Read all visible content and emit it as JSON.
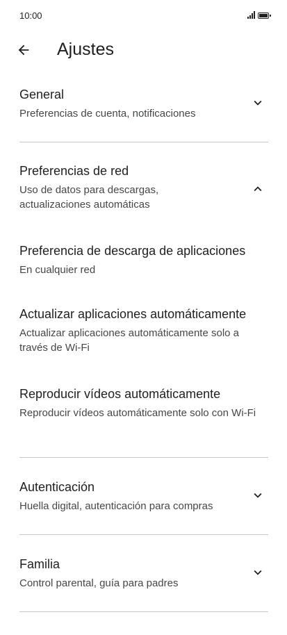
{
  "status": {
    "time": "10:00"
  },
  "header": {
    "title": "Ajustes"
  },
  "sections": [
    {
      "title": "General",
      "subtitle": "Preferencias de cuenta, notificaciones"
    },
    {
      "title": "Preferencias de red",
      "subtitle": "Uso de datos para descargas, actualizaciones automáticas"
    },
    {
      "title": "Preferencia de descarga de aplicaciones",
      "subtitle": "En cualquier red"
    },
    {
      "title": "Actualizar aplicaciones automáticamente",
      "subtitle": "Actualizar aplicaciones automáticamente solo a través de Wi-Fi"
    },
    {
      "title": "Reproducir vídeos automáticamente",
      "subtitle": "Reproducir vídeos automáticamente solo con Wi-Fi"
    },
    {
      "title": "Autenticación",
      "subtitle": "Huella digital, autenticación para compras"
    },
    {
      "title": "Familia",
      "subtitle": "Control parental, guía para padres"
    }
  ]
}
